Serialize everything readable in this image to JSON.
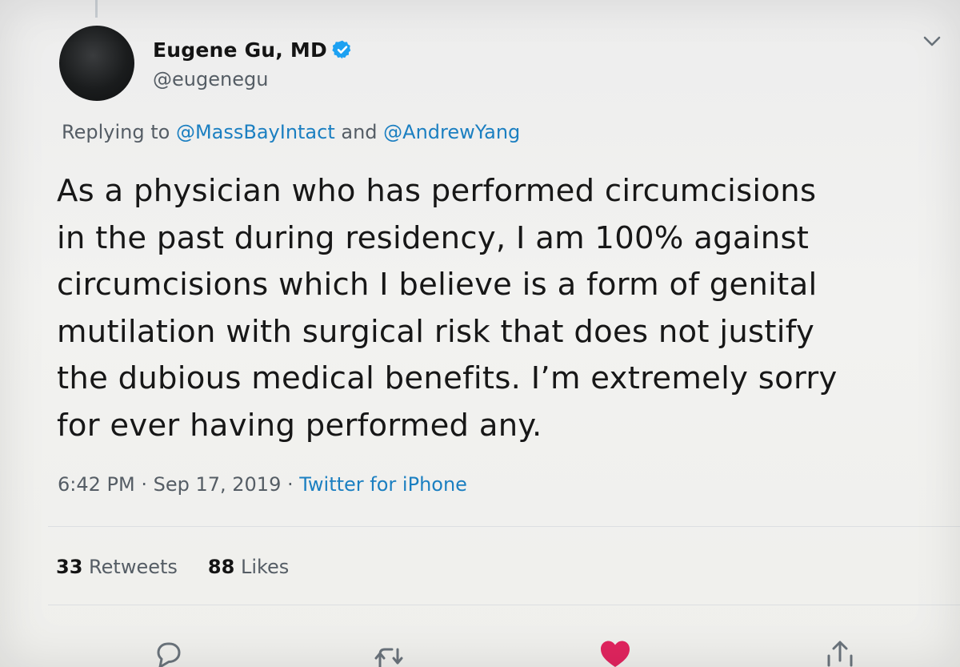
{
  "author": {
    "name": "Eugene Gu, MD",
    "handle": "@eugenegu",
    "verified": true
  },
  "reply": {
    "prefix": "Replying to ",
    "mention1": "@MassBayIntact",
    "joiner": " and ",
    "mention2": "@AndrewYang"
  },
  "tweet": {
    "lines": [
      "As a physician who has performed circumcisions",
      "in the past during residency, I am 100% against",
      "circumcisions which I believe is a form of genital",
      "mutilation with surgical risk that does not justify",
      "the dubious medical benefits. I’m extremely sorry",
      "for ever having performed any."
    ]
  },
  "meta": {
    "time": "6:42 PM",
    "separator1": " · ",
    "date": "Sep 17, 2019",
    "separator2": " · ",
    "source": "Twitter for iPhone"
  },
  "stats": {
    "retweets_count": "33",
    "retweets_label": "Retweets",
    "likes_count": "88",
    "likes_label": "Likes"
  },
  "colors": {
    "link": "#1b7fc1",
    "like_active": "#e0245e",
    "verified": "#1da1f2"
  },
  "icons": {
    "reply": "reply-icon",
    "retweet": "retweet-icon",
    "like": "heart-icon",
    "share": "share-icon",
    "verified": "verified-badge-icon",
    "more": "chevron-down-icon"
  }
}
